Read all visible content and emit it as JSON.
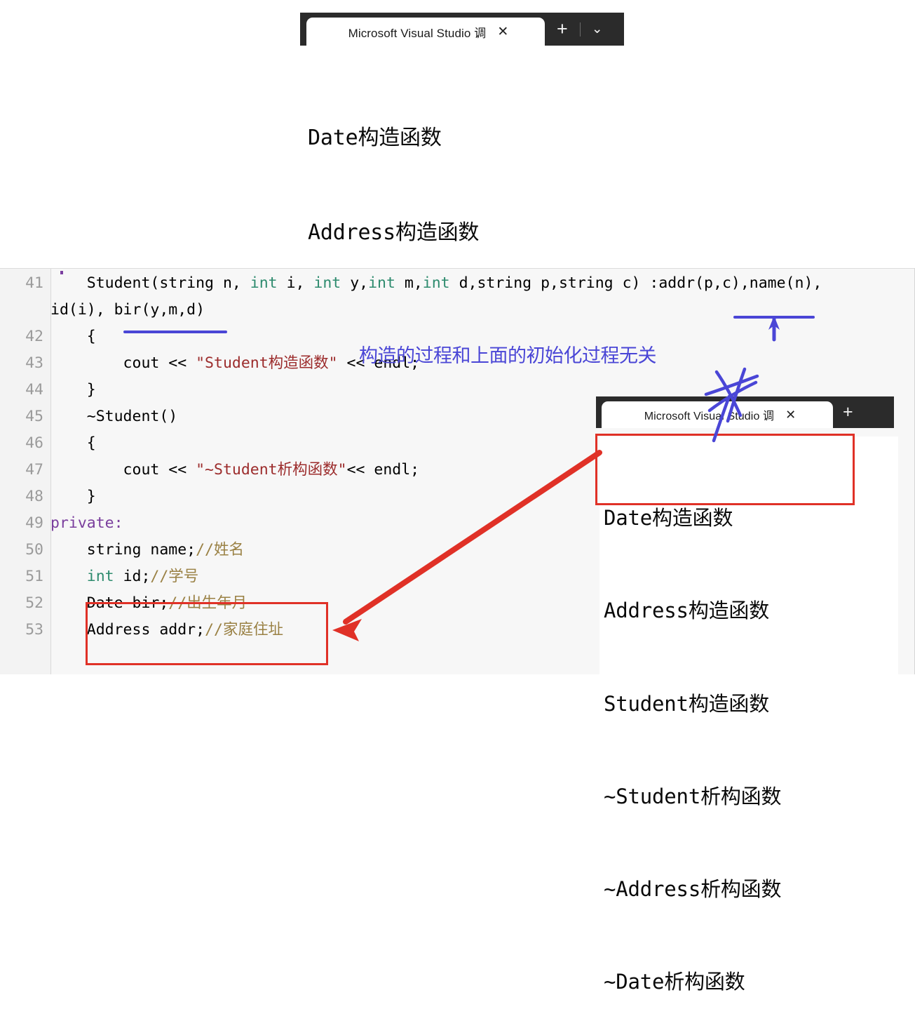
{
  "terminal_top": {
    "tab_title": "Microsoft Visual Studio 调",
    "close_icon": "close-icon",
    "new_tab_icon": "plus-icon",
    "dropdown_icon": "chevron-down-icon",
    "output_lines": [
      "Date构造函数",
      "Address构造函数",
      "Student构造函数",
      "~Student析构函数",
      "~Address析构函数",
      "~Date析构函数"
    ]
  },
  "terminal_bottom": {
    "tab_title": "Microsoft Visual Studio 调",
    "close_icon": "close-icon",
    "new_tab_icon": "plus-icon",
    "output_lines": [
      "Date构造函数",
      "Address构造函数",
      "Student构造函数",
      "~Student析构函数",
      "~Address析构函数",
      "~Date析构函数"
    ]
  },
  "editor": {
    "lines": [
      {
        "number": "41",
        "segments": [
          {
            "t": "    Student(string n, ",
            "c": "plain"
          },
          {
            "t": "int",
            "c": "type"
          },
          {
            "t": " i, ",
            "c": "plain"
          },
          {
            "t": "int",
            "c": "type"
          },
          {
            "t": " y,",
            "c": "plain"
          },
          {
            "t": "int",
            "c": "type"
          },
          {
            "t": " m,",
            "c": "plain"
          },
          {
            "t": "int",
            "c": "type"
          },
          {
            "t": " d,string p,string c) :addr(p,c),name(n),",
            "c": "plain"
          }
        ]
      },
      {
        "number": "",
        "segments": [
          {
            "t": "id(i), bir(y,m,d)",
            "c": "plain"
          }
        ]
      },
      {
        "number": "42",
        "segments": [
          {
            "t": "    {",
            "c": "plain"
          }
        ]
      },
      {
        "number": "43",
        "segments": [
          {
            "t": "        cout << ",
            "c": "plain"
          },
          {
            "t": "\"Student构造函数\"",
            "c": "string"
          },
          {
            "t": " << endl;",
            "c": "plain"
          }
        ]
      },
      {
        "number": "44",
        "segments": [
          {
            "t": "    }",
            "c": "plain"
          }
        ]
      },
      {
        "number": "45",
        "segments": [
          {
            "t": "    ~Student()",
            "c": "plain"
          }
        ]
      },
      {
        "number": "46",
        "segments": [
          {
            "t": "    {",
            "c": "plain"
          }
        ]
      },
      {
        "number": "47",
        "segments": [
          {
            "t": "        cout << ",
            "c": "plain"
          },
          {
            "t": "\"~Student析构函数\"",
            "c": "string"
          },
          {
            "t": "<< endl;",
            "c": "plain"
          }
        ]
      },
      {
        "number": "48",
        "segments": [
          {
            "t": "    }",
            "c": "plain"
          }
        ]
      },
      {
        "number": "49",
        "segments": [
          {
            "t": "private:",
            "c": "keyword"
          }
        ]
      },
      {
        "number": "50",
        "segments": [
          {
            "t": "    string name;",
            "c": "plain"
          },
          {
            "t": "//姓名",
            "c": "comment"
          }
        ]
      },
      {
        "number": "51",
        "segments": [
          {
            "t": "    ",
            "c": "plain"
          },
          {
            "t": "int",
            "c": "type"
          },
          {
            "t": " id;",
            "c": "plain"
          },
          {
            "t": "//学号",
            "c": "comment"
          }
        ]
      },
      {
        "number": "52",
        "segments": [
          {
            "t": "    Date bir;",
            "c": "plain"
          },
          {
            "t": "//出生年月",
            "c": "comment"
          }
        ]
      },
      {
        "number": "53",
        "segments": [
          {
            "t": "    Address addr;",
            "c": "plain"
          },
          {
            "t": "//家庭住址",
            "c": "comment"
          }
        ]
      }
    ]
  },
  "annotations": {
    "blue_note": "构造的过程和上面的初始化过程无关",
    "blue_color": "#4a46d6",
    "red_color": "#e03127",
    "underline_addr": "addr(p,c)",
    "underline_bir": "bir(y,m,d)",
    "star_mark": "star-mark-icon",
    "arrow_up": "arrow-up-icon",
    "arrow_red": "red-arrow-icon",
    "red_box_code": "Date bir / Address addr fields",
    "red_box_output": "Date构造函数 / Address构造函数"
  }
}
